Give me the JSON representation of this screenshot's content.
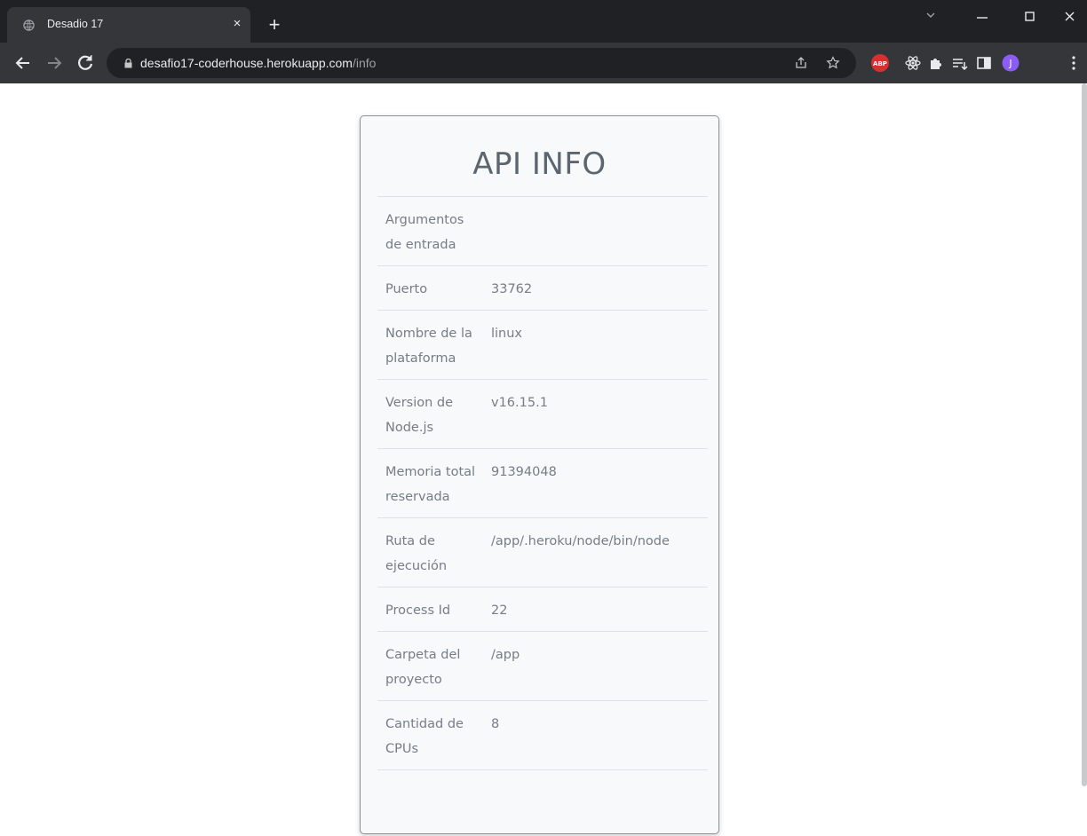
{
  "browser": {
    "tab": {
      "title": "Desadio 17",
      "close": "×"
    },
    "new_tab": "+",
    "address": {
      "host": "desafio17-coderhouse.herokuapp.com",
      "path": "/info"
    },
    "profile_initial": "J",
    "adblock_label": "ABP"
  },
  "page": {
    "title": "API INFO",
    "rows": [
      {
        "key": "Argumentos de entrada",
        "value": ""
      },
      {
        "key": "Puerto",
        "value": "33762"
      },
      {
        "key": "Nombre de la plataforma",
        "value": "linux"
      },
      {
        "key": "Version de Node.js",
        "value": "v16.15.1"
      },
      {
        "key": "Memoria total reservada",
        "value": "91394048"
      },
      {
        "key": "Ruta de ejecución",
        "value": "/app/.heroku/node/bin/node"
      },
      {
        "key": "Process Id",
        "value": "22"
      },
      {
        "key": "Carpeta del proyecto",
        "value": "/app"
      },
      {
        "key": "Cantidad de CPUs",
        "value": "8"
      }
    ]
  },
  "colors": {
    "chrome_dark": "#202124",
    "chrome_toolbar": "#35363a",
    "card_bg": "#f8f9fa",
    "text_muted": "#767d85",
    "title": "#5c6670",
    "adblock_red": "#d92f2f",
    "profile_purple": "#8b5cf6"
  }
}
